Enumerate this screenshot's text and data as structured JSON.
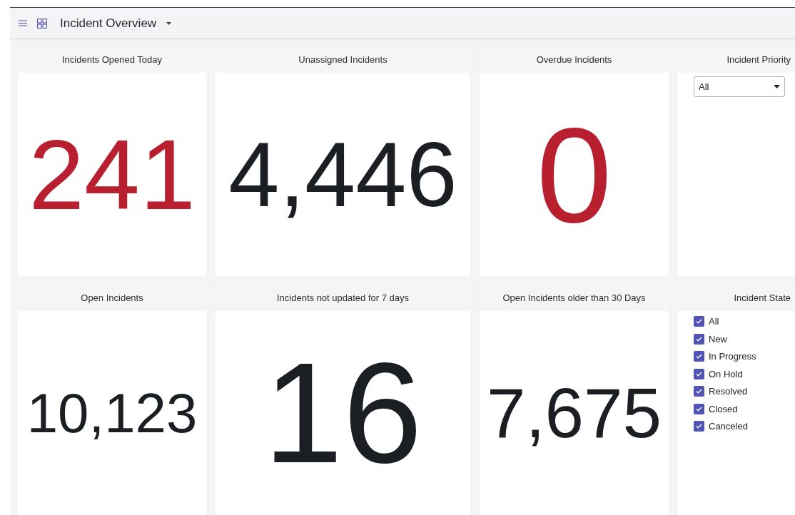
{
  "header": {
    "title": "Incident Overview"
  },
  "tiles": [
    {
      "title": "Incidents Opened Today",
      "value": "241",
      "color": "#b8202f"
    },
    {
      "title": "Unassigned Incidents",
      "value": "4,446",
      "color": "#1b1e23"
    },
    {
      "title": "Overdue Incidents",
      "value": "0",
      "color": "#b8202f"
    },
    {
      "title": "Open Incidents",
      "value": "10,123",
      "color": "#1b1e23"
    },
    {
      "title": "Incidents not updated for 7 days",
      "value": "16",
      "color": "#1b1e23"
    },
    {
      "title": "Open Incidents older than 30 Days",
      "value": "7,675",
      "color": "#1b1e23"
    }
  ],
  "priority_filter": {
    "title": "Incident Priority",
    "value": "All"
  },
  "state_filter": {
    "title": "Incident State",
    "options": [
      {
        "label": "All",
        "checked": true
      },
      {
        "label": "New",
        "checked": true
      },
      {
        "label": "In Progress",
        "checked": true
      },
      {
        "label": "On Hold",
        "checked": true
      },
      {
        "label": "Resolved",
        "checked": true
      },
      {
        "label": "Closed",
        "checked": true
      },
      {
        "label": "Canceled",
        "checked": true
      }
    ]
  }
}
